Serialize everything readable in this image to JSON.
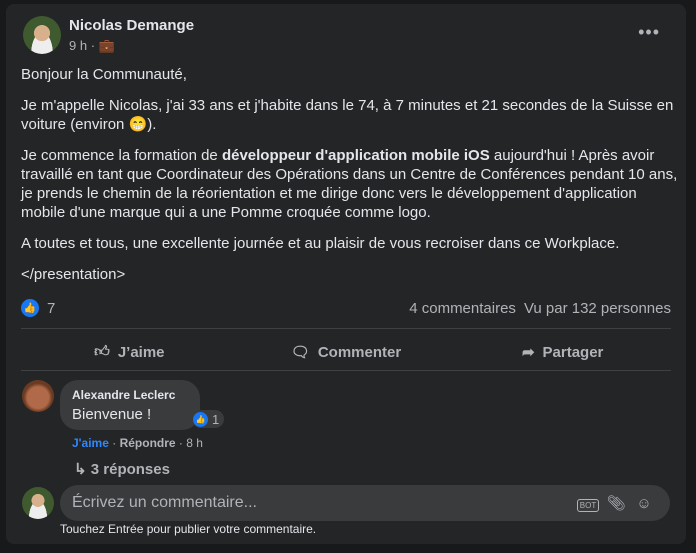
{
  "post": {
    "author": "Nicolas Demange",
    "time": "9 h",
    "visibility_icon": "briefcase-icon",
    "more": "•••",
    "paragraphs": [
      {
        "text": "Bonjour la Communauté,"
      },
      {
        "text": "Je m'appelle Nicolas, j'ai 33 ans et j'habite dans le 74, à 7 minutes et 21 secondes de la Suisse en voiture (environ 😁)."
      },
      {
        "pre": "Je commence la formation de ",
        "bold": "développeur d'application mobile iOS",
        "post": " aujourd'hui ! Après avoir travaillé en tant que Coordinateur des Opérations dans un Centre de Conférences pendant 10 ans, je prends le chemin de la réorientation et me dirige donc vers le développement d'application mobile d'une marque qui a une Pomme croquée comme logo."
      },
      {
        "text": "A toutes et tous, une excellente journée et au plaisir de vous recroiser dans ce Workplace."
      },
      {
        "text": "</presentation>"
      }
    ]
  },
  "stats": {
    "likes": "7",
    "comments": "4 commentaires",
    "views": "Vu par 132 personnes"
  },
  "actions": {
    "like": "J’aime",
    "comment": "Commenter",
    "share": "Partager"
  },
  "comment": {
    "author": "Alexandre Leclerc",
    "text": "Bienvenue !",
    "reactions": "1",
    "like": "J'aime",
    "reply": "Répondre",
    "time": "8 h",
    "sep": " · ",
    "replies": "3 réponses"
  },
  "composer": {
    "placeholder": "Écrivez un commentaire...",
    "hint": "Touchez Entrée pour publier votre commentaire."
  },
  "colors": {
    "accent": "#2d88ff",
    "card": "#242526",
    "background": "#18191a"
  }
}
